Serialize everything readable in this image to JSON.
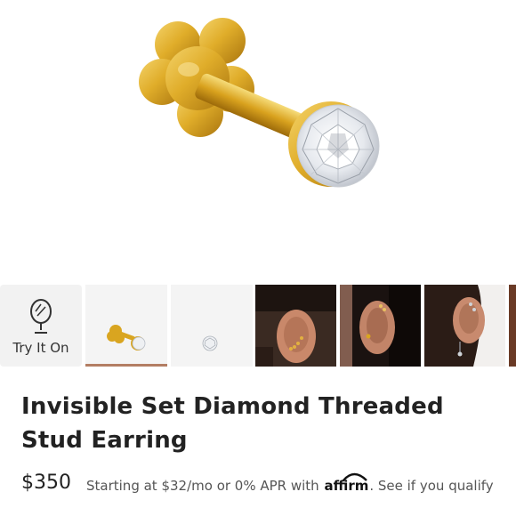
{
  "product": {
    "title": "Invisible Set Diamond Threaded Stud Earring",
    "price": "$350"
  },
  "financing": {
    "text": "Starting at $32/mo or 0% APR with",
    "brand": "affirm",
    "link": ". See if you qualify"
  },
  "gallery": {
    "try_on_label": "Try It On",
    "selected_index": 1
  },
  "colors": {
    "gold": "#d9a520",
    "selected_indicator": "#b37e63",
    "thumb_bg": "#f4f4f4"
  }
}
